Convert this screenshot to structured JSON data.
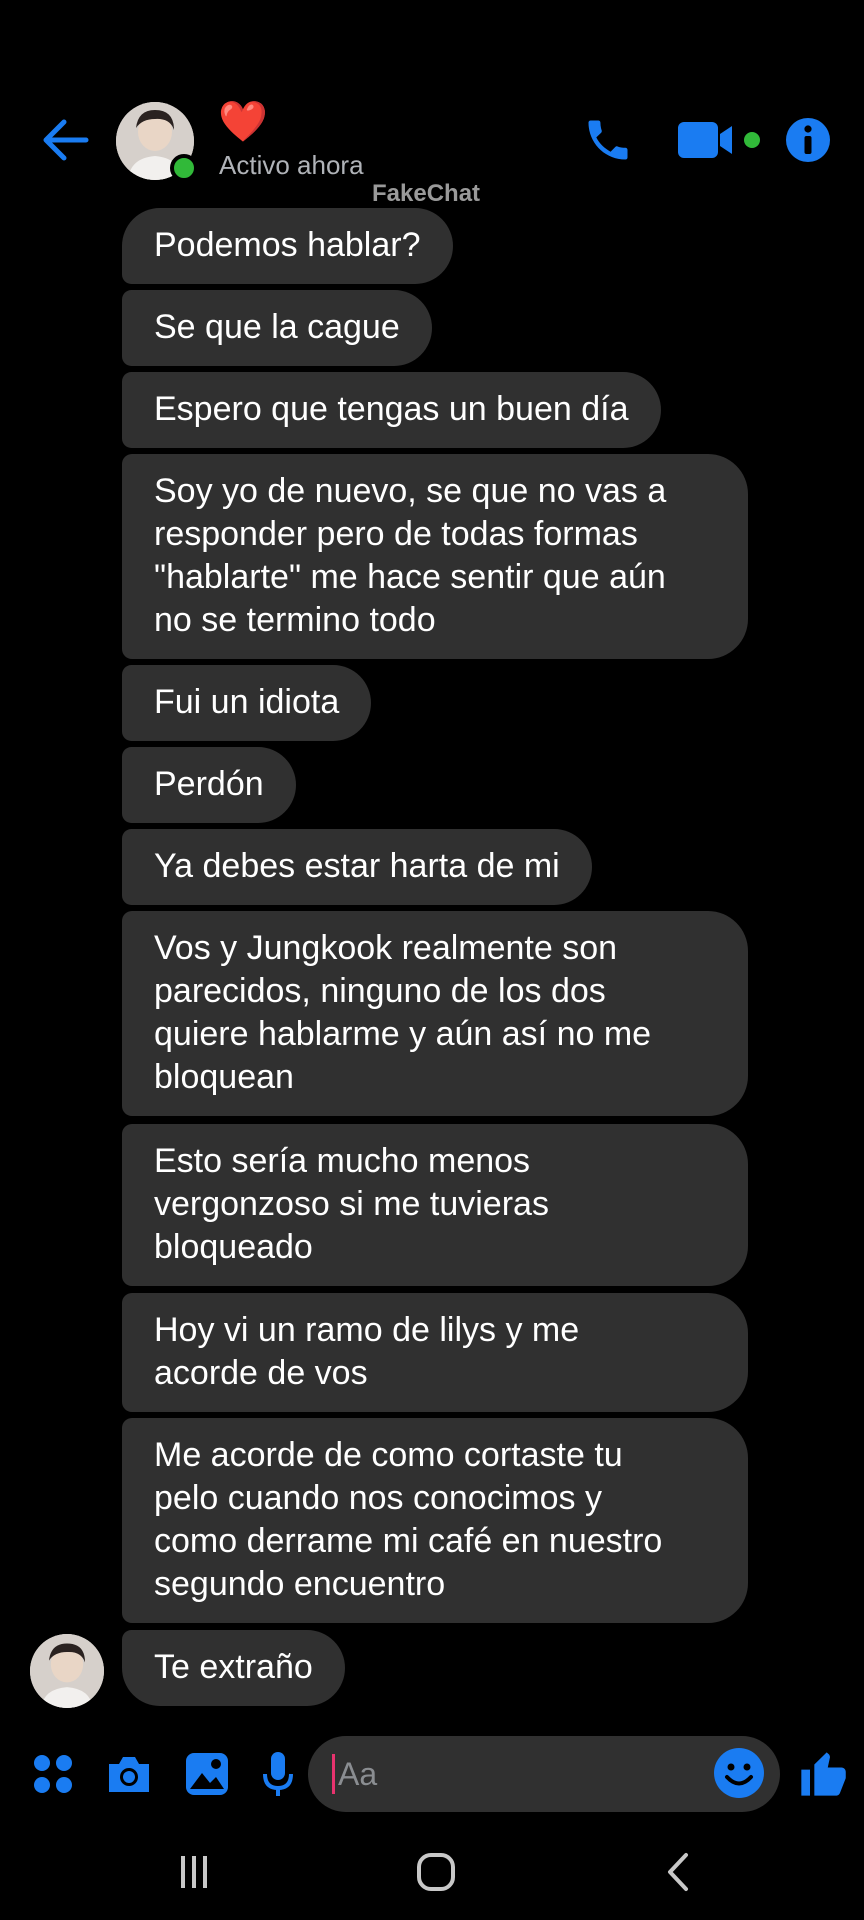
{
  "header": {
    "name": "❤️",
    "status": "Activo ahora",
    "watermark": "FakeChat",
    "icons": [
      "back-arrow-icon",
      "phone-icon",
      "video-camera-icon",
      "info-icon"
    ]
  },
  "accent_color": "#1a7cf2",
  "online_color": "#31b939",
  "messages": [
    {
      "text": "Podemos hablar?"
    },
    {
      "text": "Se que la cague"
    },
    {
      "text": "Espero que tengas un buen día"
    },
    {
      "text": "Soy yo de nuevo, se que no vas a\nresponder pero de todas formas\n\"hablarte\" me hace sentir que aún\nno se termino todo"
    },
    {
      "text": "Fui un idiota"
    },
    {
      "text": "Perdón"
    },
    {
      "text": "Ya debes estar harta de mi"
    },
    {
      "text": "Vos y Jungkook realmente son\nparecidos, ninguno de los dos\nquiere hablarme y aún así no me\nbloquean"
    },
    {
      "text": "Esto sería mucho menos\nvergonzoso si me tuvieras\nbloqueado"
    },
    {
      "text": "Hoy vi un ramo de lilys y me\nacorde de vos"
    },
    {
      "text": "Me acorde de como cortaste tu\npelo cuando nos conocimos y\ncomo derrame mi café en nuestro\nsegundo encuentro"
    },
    {
      "text": "Te extraño"
    }
  ],
  "composer": {
    "placeholder": "Aa",
    "icons": [
      "apps-grid-icon",
      "camera-icon",
      "gallery-icon",
      "microphone-icon",
      "emoji-icon",
      "thumbs-up-icon"
    ]
  },
  "system_nav": {
    "icons": [
      "recents-icon",
      "home-icon",
      "back-icon"
    ]
  }
}
